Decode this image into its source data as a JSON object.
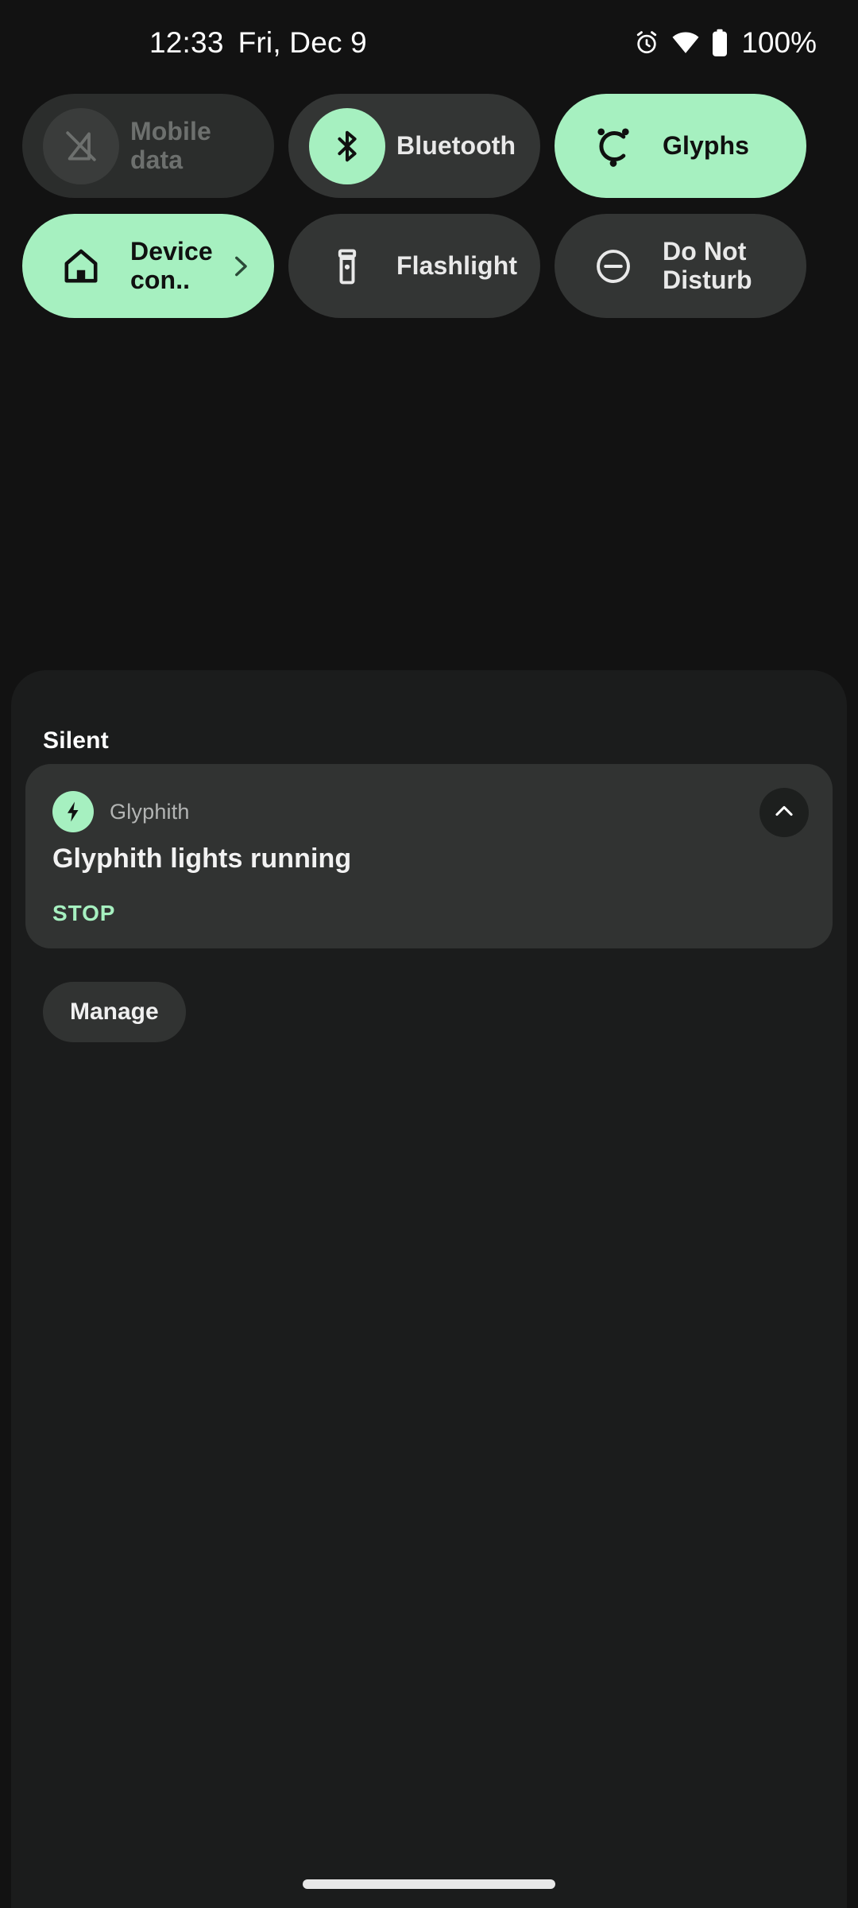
{
  "status_bar": {
    "time": "12:33",
    "date": "Fri, Dec 9",
    "battery_percent": "100%",
    "icons": [
      "alarm-icon",
      "wifi-icon",
      "battery-icon"
    ]
  },
  "quick_settings": {
    "tiles": [
      {
        "id": "mobile-data",
        "label": "Mobile data",
        "icon": "mobile-data-off-icon",
        "state": "disabled",
        "has_chevron": false
      },
      {
        "id": "bluetooth",
        "label": "Bluetooth",
        "icon": "bluetooth-icon",
        "state": "on-icon-highlight",
        "has_chevron": false
      },
      {
        "id": "glyphs",
        "label": "Glyphs",
        "icon": "glyph-c-icon",
        "state": "active",
        "has_chevron": false
      },
      {
        "id": "device-controls",
        "label": "Device con..",
        "icon": "home-icon",
        "state": "active",
        "has_chevron": true,
        "chevron": "chevron-right-icon"
      },
      {
        "id": "flashlight",
        "label": "Flashlight",
        "icon": "flashlight-icon",
        "state": "off",
        "has_chevron": false
      },
      {
        "id": "do-not-disturb",
        "label": "Do Not Disturb",
        "icon": "do-not-disturb-icon",
        "state": "off",
        "has_chevron": false
      }
    ]
  },
  "notification_shade": {
    "section_label": "Silent",
    "notification": {
      "app_name": "Glyphith",
      "app_icon": "bolt-icon",
      "title": "Glyphith lights running",
      "action_label": "STOP",
      "expand_icon": "chevron-up-icon"
    },
    "manage_label": "Manage"
  },
  "nav": {
    "pill": "home-gesture-pill"
  },
  "colors": {
    "accent_green": "#a6f0c0",
    "tile_off": "#333534",
    "tile_disabled": "#2b2d2c",
    "shade_bg": "#1b1c1c",
    "screen_bg": "#121212",
    "card_bg": "#313332"
  }
}
